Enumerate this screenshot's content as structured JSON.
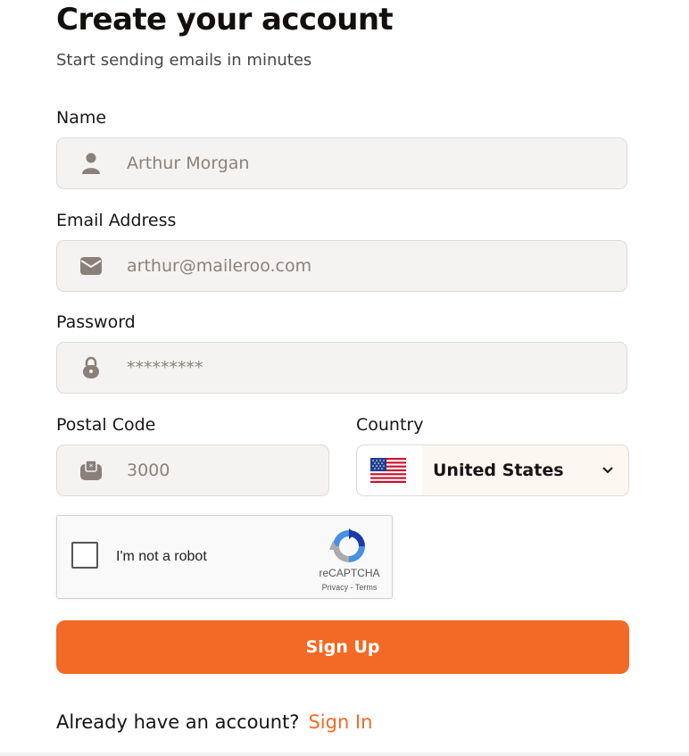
{
  "header": {
    "title": "Create your account",
    "subtitle": "Start sending emails in minutes"
  },
  "form": {
    "name": {
      "label": "Name",
      "placeholder": "Arthur Morgan",
      "icon": "user-icon"
    },
    "email": {
      "label": "Email Address",
      "placeholder": "arthur@maileroo.com",
      "icon": "envelope-icon"
    },
    "password": {
      "label": "Password",
      "placeholder": "*********",
      "icon": "lock-icon"
    },
    "postal_code": {
      "label": "Postal Code",
      "placeholder": "3000",
      "icon": "mailbox-icon"
    },
    "country": {
      "label": "Country",
      "value": "United States",
      "icon": "us-flag-icon"
    }
  },
  "captcha": {
    "checkbox_label": "I'm not a robot",
    "brand": "reCAPTCHA",
    "links": "Privacy - Terms"
  },
  "submit": {
    "label": "Sign Up"
  },
  "footer": {
    "prompt": "Already have an account?",
    "link": "Sign In"
  },
  "colors": {
    "accent": "#f26a25",
    "field_bg": "#f5f3f1",
    "text": "#171412"
  }
}
